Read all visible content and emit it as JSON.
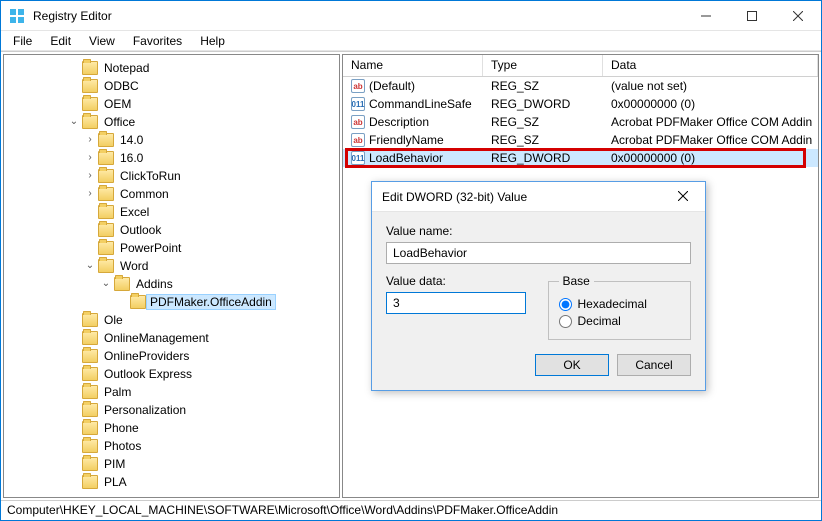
{
  "window": {
    "title": "Registry Editor"
  },
  "menu": {
    "file": "File",
    "edit": "Edit",
    "view": "View",
    "favorites": "Favorites",
    "help": "Help"
  },
  "tree": {
    "items": [
      {
        "depth": 4,
        "exp": null,
        "label": "Notepad"
      },
      {
        "depth": 4,
        "exp": null,
        "label": "ODBC"
      },
      {
        "depth": 4,
        "exp": null,
        "label": "OEM"
      },
      {
        "depth": 4,
        "exp": "open",
        "label": "Office"
      },
      {
        "depth": 5,
        "exp": "closed",
        "label": "14.0"
      },
      {
        "depth": 5,
        "exp": "closed",
        "label": "16.0"
      },
      {
        "depth": 5,
        "exp": "closed",
        "label": "ClickToRun"
      },
      {
        "depth": 5,
        "exp": "closed",
        "label": "Common"
      },
      {
        "depth": 5,
        "exp": null,
        "label": "Excel"
      },
      {
        "depth": 5,
        "exp": null,
        "label": "Outlook"
      },
      {
        "depth": 5,
        "exp": null,
        "label": "PowerPoint"
      },
      {
        "depth": 5,
        "exp": "open",
        "label": "Word"
      },
      {
        "depth": 6,
        "exp": "open",
        "label": "Addins"
      },
      {
        "depth": 7,
        "exp": null,
        "label": "PDFMaker.OfficeAddin",
        "selected": true
      },
      {
        "depth": 4,
        "exp": null,
        "label": "Ole"
      },
      {
        "depth": 4,
        "exp": null,
        "label": "OnlineManagement"
      },
      {
        "depth": 4,
        "exp": null,
        "label": "OnlineProviders"
      },
      {
        "depth": 4,
        "exp": null,
        "label": "Outlook Express"
      },
      {
        "depth": 4,
        "exp": null,
        "label": "Palm"
      },
      {
        "depth": 4,
        "exp": null,
        "label": "Personalization"
      },
      {
        "depth": 4,
        "exp": null,
        "label": "Phone"
      },
      {
        "depth": 4,
        "exp": null,
        "label": "Photos"
      },
      {
        "depth": 4,
        "exp": null,
        "label": "PIM"
      },
      {
        "depth": 4,
        "exp": null,
        "label": "PLA"
      }
    ]
  },
  "list": {
    "columns": {
      "name": "Name",
      "type": "Type",
      "data": "Data"
    },
    "rows": [
      {
        "icon": "sz",
        "name": "(Default)",
        "type": "REG_SZ",
        "data": "(value not set)"
      },
      {
        "icon": "bin",
        "name": "CommandLineSafe",
        "type": "REG_DWORD",
        "data": "0x00000000 (0)"
      },
      {
        "icon": "sz",
        "name": "Description",
        "type": "REG_SZ",
        "data": "Acrobat PDFMaker Office COM Addin"
      },
      {
        "icon": "sz",
        "name": "FriendlyName",
        "type": "REG_SZ",
        "data": "Acrobat PDFMaker Office COM Addin"
      },
      {
        "icon": "bin",
        "name": "LoadBehavior",
        "type": "REG_DWORD",
        "data": "0x00000000 (0)",
        "selected": true,
        "highlighted": true
      }
    ]
  },
  "statusbar": {
    "path": "Computer\\HKEY_LOCAL_MACHINE\\SOFTWARE\\Microsoft\\Office\\Word\\Addins\\PDFMaker.OfficeAddin"
  },
  "dialog": {
    "title": "Edit DWORD (32-bit) Value",
    "valuename_label": "Value name:",
    "valuename": "LoadBehavior",
    "valuedata_label": "Value data:",
    "valuedata": "3",
    "base_label": "Base",
    "hex_label": "Hexadecimal",
    "dec_label": "Decimal",
    "base_selected": "hex",
    "ok": "OK",
    "cancel": "Cancel"
  }
}
